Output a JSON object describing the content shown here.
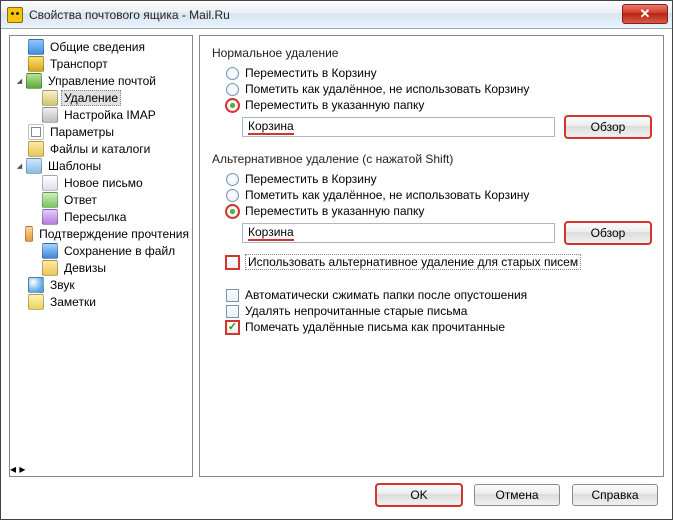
{
  "window": {
    "title": "Свойства почтового ящика - Mail.Ru",
    "close": "✕"
  },
  "tree": {
    "general": "Общие сведения",
    "transport": "Транспорт",
    "mailmgmt": "Управление почтой",
    "deletion": "Удаление",
    "imap": "Настройка IMAP",
    "params": "Параметры",
    "files": "Файлы и каталоги",
    "templates": "Шаблоны",
    "newmail": "Новое письмо",
    "reply": "Ответ",
    "forward": "Пересылка",
    "confirm": "Подтверждение прочтения",
    "save": "Сохранение в файл",
    "motto": "Девизы",
    "sound": "Звук",
    "notes": "Заметки"
  },
  "panel": {
    "normal_title": "Нормальное удаление",
    "alt_title": "Альтернативное удаление (с нажатой Shift)",
    "opt_move_trash": "Переместить в Корзину",
    "opt_mark_deleted": "Пометить как удалённое, не использовать Корзину",
    "opt_move_folder": "Переместить в указанную папку",
    "folder1": "Корзина",
    "folder2": "Корзина",
    "browse": "Обзор",
    "use_alt_old": "Использовать альтернативное удаление для старых писем",
    "compact": "Автоматически сжимать папки после опустошения",
    "del_unread": "Удалять непрочитанные старые письма",
    "mark_read": "Помечать удалённые письма как прочитанные"
  },
  "footer": {
    "ok": "OK",
    "cancel": "Отмена",
    "help": "Справка"
  }
}
